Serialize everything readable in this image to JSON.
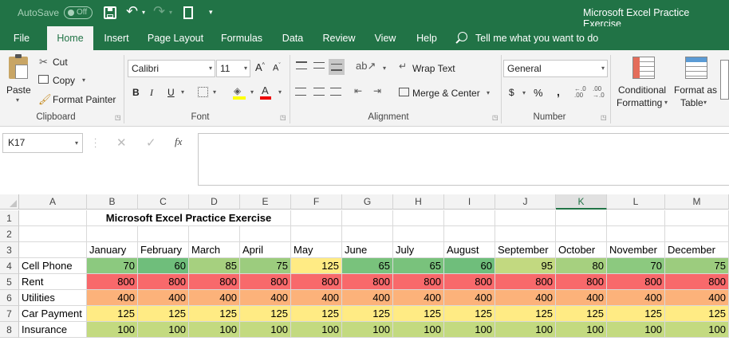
{
  "titlebar": {
    "autosave_label": "AutoSave",
    "autosave_state": "Off",
    "title": "Microsoft Excel Practice Exercise"
  },
  "tabs": [
    "File",
    "Home",
    "Insert",
    "Page Layout",
    "Formulas",
    "Data",
    "Review",
    "View",
    "Help"
  ],
  "tell_me": "Tell me what you want to do",
  "ribbon": {
    "clipboard": {
      "paste": "Paste",
      "cut": "Cut",
      "copy": "Copy",
      "format_painter": "Format Painter",
      "label": "Clipboard"
    },
    "font": {
      "family": "Calibri",
      "size": "11",
      "bold": "B",
      "italic": "I",
      "underline": "U",
      "label": "Font"
    },
    "alignment": {
      "wrap": "Wrap Text",
      "merge": "Merge & Center",
      "label": "Alignment"
    },
    "number": {
      "format": "General",
      "currency": "$",
      "percent": "%",
      "comma": ",",
      "label": "Number"
    },
    "styles": {
      "conditional": "Conditional",
      "conditional2": "Formatting",
      "format_as": "Format as",
      "format_as2": "Table"
    }
  },
  "formula_bar": {
    "name_box": "K17",
    "fx": "fx",
    "content": ""
  },
  "columns": [
    "A",
    "B",
    "C",
    "D",
    "E",
    "F",
    "G",
    "H",
    "I",
    "J",
    "K",
    "L",
    "M"
  ],
  "selected_column": "K",
  "rows": [
    "1",
    "2",
    "3",
    "4",
    "5",
    "6",
    "7",
    "8"
  ],
  "sheet": {
    "title": "Microsoft Excel Practice Exercise",
    "months": [
      "January",
      "February",
      "March",
      "April",
      "May",
      "June",
      "July",
      "August",
      "September",
      "October",
      "November",
      "December"
    ],
    "data": [
      {
        "label": "Cell Phone",
        "values": [
          70,
          60,
          85,
          75,
          125,
          65,
          65,
          60,
          95,
          80,
          70,
          75
        ],
        "colors": [
          "#8cc97f",
          "#6fbe7b",
          "#a6d07f",
          "#9ccc7e",
          "#ffeb84",
          "#79c27c",
          "#79c27c",
          "#6fbe7b",
          "#c2d980",
          "#a6d07f",
          "#8cc97f",
          "#9ccc7e"
        ]
      },
      {
        "label": "Rent",
        "values": [
          800,
          800,
          800,
          800,
          800,
          800,
          800,
          800,
          800,
          800,
          800,
          800
        ],
        "color": "#f8696b"
      },
      {
        "label": "Utilities",
        "values": [
          400,
          400,
          400,
          400,
          400,
          400,
          400,
          400,
          400,
          400,
          400,
          400
        ],
        "color": "#fcb27a"
      },
      {
        "label": "Car Payment",
        "values": [
          125,
          125,
          125,
          125,
          125,
          125,
          125,
          125,
          125,
          125,
          125,
          125
        ],
        "color": "#ffeb84"
      },
      {
        "label": "Insurance",
        "values": [
          100,
          100,
          100,
          100,
          100,
          100,
          100,
          100,
          100,
          100,
          100,
          100
        ],
        "color": "#c3da80"
      }
    ]
  }
}
